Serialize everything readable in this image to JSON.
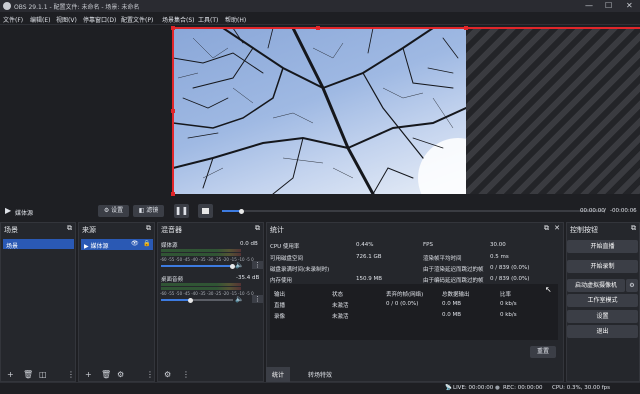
{
  "window": {
    "title": "OBS 29.1.1 - 配置文件: 未命名 - 场景: 未命名",
    "controls": [
      "—",
      "☐",
      "✕"
    ]
  },
  "menu": [
    "文件(F)",
    "编辑(E)",
    "视图(V)",
    "停靠窗口(D)",
    "配置文件(P)",
    "场景集合(S)",
    "工具(T)",
    "帮助(H)"
  ],
  "colors": {
    "accent": "#2a59b4",
    "selection_border": "#e0262a",
    "button": "#3b3e46",
    "panel": "#25272c"
  },
  "mediabar": {
    "source_name": "媒体源",
    "settings_label": "设置",
    "filters_label": "滤镜",
    "time_current": "00:00:00",
    "time_sep": "/",
    "time_total": "-00:00:06",
    "progress": 0.05
  },
  "scenes": {
    "title": "场景",
    "items": [
      "场景"
    ]
  },
  "sources": {
    "title": "来源",
    "items": [
      "媒体源"
    ]
  },
  "mixer": {
    "title": "混音器",
    "channels": [
      {
        "name": "媒体源",
        "db": "0.0 dB",
        "level": 1.0
      },
      {
        "name": "桌面音频",
        "db": "-35.4 dB",
        "level": 0.42
      }
    ],
    "ticks": "-60 -55 -50 -45 -40 -35 -30 -25 -20 -15 -10 -5 0"
  },
  "stats": {
    "title": "统计",
    "left": [
      {
        "label": "CPU 使用率",
        "value": "0.44%"
      },
      {
        "label": "可用磁盘空间",
        "value": "726.1 GB"
      },
      {
        "label": "磁盘录满时间(未录制时)",
        "value": ""
      },
      {
        "label": "内存使用",
        "value": "150.9 MB"
      }
    ],
    "right": [
      {
        "label": "FPS",
        "value": "30.00"
      },
      {
        "label": "渲染帧平均时间",
        "value": "0.5 ms"
      },
      {
        "label": "由于渲染延迟而跳过的帧",
        "value": "0 / 839 (0.0%)"
      },
      {
        "label": "由于编码延迟而跳过的帧",
        "value": "0 / 839 (0.0%)"
      }
    ],
    "table_headers": [
      "输出",
      "状态",
      "丢弃的帧(网络)",
      "总数据输出",
      "比率"
    ],
    "table_rows": [
      [
        "直播",
        "未激活",
        "0 / 0 (0.0%)",
        "0.0 MB",
        "0 kb/s"
      ],
      [
        "录像",
        "未激活",
        "",
        "0.0 MB",
        "0 kb/s"
      ]
    ],
    "reset_label": "重置",
    "tabs": [
      "统计",
      "转场特效"
    ]
  },
  "controls": {
    "title": "控制按钮",
    "buttons": [
      "开始直播",
      "开始录制",
      "启动虚拟摄像机",
      "工作室模式",
      "设置",
      "退出"
    ]
  },
  "status": {
    "live": "LIVE: 00:00:00",
    "rec": "REC: 00:00:00",
    "cpu": "CPU: 0.3%, 30.00 fps"
  }
}
